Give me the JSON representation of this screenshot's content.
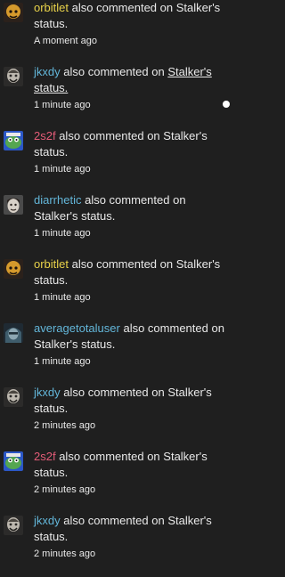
{
  "notifications": [
    {
      "avatar_icon": "orbitlet-avatar",
      "user": "orbitlet",
      "user_color": "#e8d24a",
      "action": "also commented on",
      "target": "Stalker's",
      "target_end": "status.",
      "time": "A moment ago",
      "unread": false
    },
    {
      "avatar_icon": "jkxdy-avatar",
      "user": "jkxdy",
      "user_color": "#63b6d9",
      "action": "also commented on",
      "target": "Stalker's",
      "target_end": "status.",
      "time": "1 minute ago",
      "unread": true
    },
    {
      "avatar_icon": "2s2f-avatar",
      "user": "2s2f",
      "user_color": "#e45c78",
      "action": "also commented on",
      "target": "Stalker's",
      "target_end": "status.",
      "time": "1 minute ago",
      "unread": false
    },
    {
      "avatar_icon": "diarrhetic-avatar",
      "user": "diarrhetic",
      "user_color": "#63b6d9",
      "action": "also commented on",
      "target": "Stalker's",
      "target_end": "status.",
      "time": "1 minute ago",
      "unread": false
    },
    {
      "avatar_icon": "orbitlet-avatar",
      "user": "orbitlet",
      "user_color": "#e8d24a",
      "action": "also commented on",
      "target": "Stalker's",
      "target_end": "status.",
      "time": "1 minute ago",
      "unread": false
    },
    {
      "avatar_icon": "averagetotaluser-avatar",
      "user": "averagetotaluser",
      "user_color": "#63b6d9",
      "action": "also commented on",
      "target": "Stalker's",
      "target_end": "status.",
      "time": "1 minute ago",
      "unread": false
    },
    {
      "avatar_icon": "jkxdy-avatar",
      "user": "jkxdy",
      "user_color": "#63b6d9",
      "action": "also commented on",
      "target": "Stalker's",
      "target_end": "status.",
      "time": "2 minutes ago",
      "unread": false
    },
    {
      "avatar_icon": "2s2f-avatar",
      "user": "2s2f",
      "user_color": "#e45c78",
      "action": "also commented on",
      "target": "Stalker's",
      "target_end": "status.",
      "time": "2 minutes ago",
      "unread": false
    },
    {
      "avatar_icon": "jkxdy-avatar",
      "user": "jkxdy",
      "user_color": "#63b6d9",
      "action": "also commented on",
      "target": "Stalker's",
      "target_end": "status.",
      "time": "2 minutes ago",
      "unread": false
    }
  ],
  "colors": {
    "background": "#1f1f1f",
    "text": "#e9e9e9",
    "unread_dot": "#ffffff"
  }
}
